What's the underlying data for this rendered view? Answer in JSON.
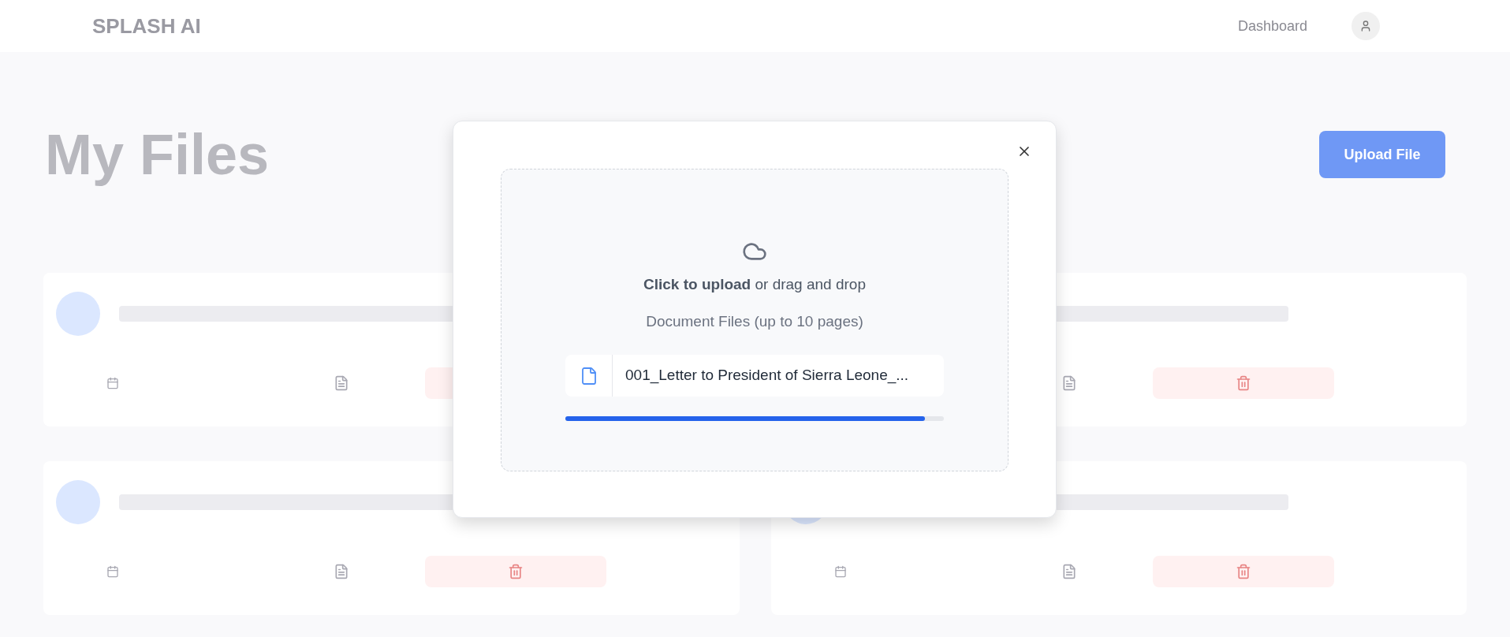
{
  "header": {
    "brand": "SPLASH AI",
    "nav_link": "Dashboard"
  },
  "page": {
    "title": "My Files",
    "upload_button": "Upload File"
  },
  "upload_dialog": {
    "prompt": "**Click to upload** or drag and drop",
    "hint": "Document Files (up to 10 pages)",
    "file": {
      "name": "001_Letter to President of Sierra Leone_...",
      "level": 0.95
    }
  }
}
